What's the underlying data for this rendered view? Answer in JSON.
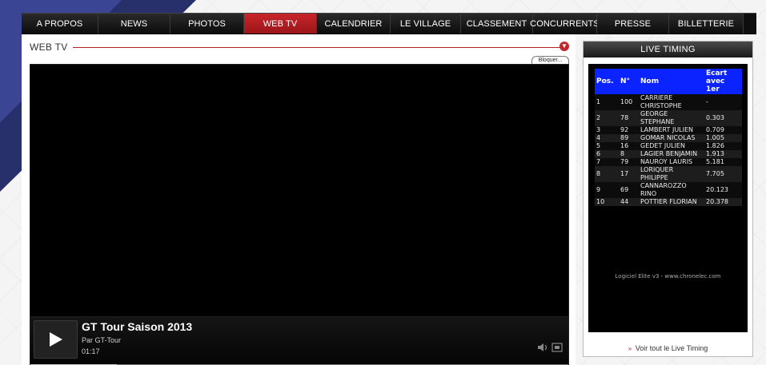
{
  "nav": {
    "items": [
      {
        "label": "A PROPOS"
      },
      {
        "label": "NEWS"
      },
      {
        "label": "PHOTOS"
      },
      {
        "label": "WEB TV",
        "active": true
      },
      {
        "label": "CALENDRIER"
      },
      {
        "label": "LE VILLAGE"
      },
      {
        "label": "CLASSEMENT"
      },
      {
        "label": "CONCURRENTS"
      },
      {
        "label": "PRESSE"
      },
      {
        "label": "BILLETTERIE"
      }
    ]
  },
  "main": {
    "section_title": "WEB TV",
    "block_button": "Bloquer...",
    "video": {
      "title": "GT Tour Saison 2013",
      "author": "Par GT-Tour",
      "duration": "01:17",
      "progress": 0.16
    }
  },
  "live_timing": {
    "title": "LIVE TIMING",
    "headers": {
      "pos": "Pos.",
      "num": "N°",
      "name": "Nom",
      "gap": "Ecart avec 1er"
    },
    "rows": [
      {
        "pos": "1",
        "num": "100",
        "name": "CARRIERE CHRISTOPHE",
        "gap": "-"
      },
      {
        "pos": "2",
        "num": "78",
        "name": "GEORGE STEPHANE",
        "gap": "0.303"
      },
      {
        "pos": "3",
        "num": "92",
        "name": "LAMBERT JULIEN",
        "gap": "0.709"
      },
      {
        "pos": "4",
        "num": "89",
        "name": "GOMAR NICOLAS",
        "gap": "1.005"
      },
      {
        "pos": "5",
        "num": "16",
        "name": "GEDET JULIEN",
        "gap": "1.826"
      },
      {
        "pos": "6",
        "num": "8",
        "name": "LAGIER BENJAMIN",
        "gap": "1.913"
      },
      {
        "pos": "7",
        "num": "79",
        "name": "NAUROY LAURIS",
        "gap": "5.181"
      },
      {
        "pos": "8",
        "num": "17",
        "name": "LORIQUER PHILIPPE",
        "gap": "7.705"
      },
      {
        "pos": "9",
        "num": "69",
        "name": "CANNAROZZO RINO",
        "gap": "20.123"
      },
      {
        "pos": "10",
        "num": "44",
        "name": "POTTIER FLORIAN",
        "gap": "20.378"
      }
    ],
    "footer": "Logiciel Elite v3 - www.chronelec.com",
    "link": "Voir tout le Live Timing"
  },
  "colors": {
    "accent": "#c0262a",
    "table_header": "#0a23ff",
    "nav_bg": "#0f0f0f"
  },
  "icons": [
    "play-icon",
    "volume-icon",
    "fullscreen-icon",
    "chevron-down-icon",
    "arrow-right-icon"
  ]
}
